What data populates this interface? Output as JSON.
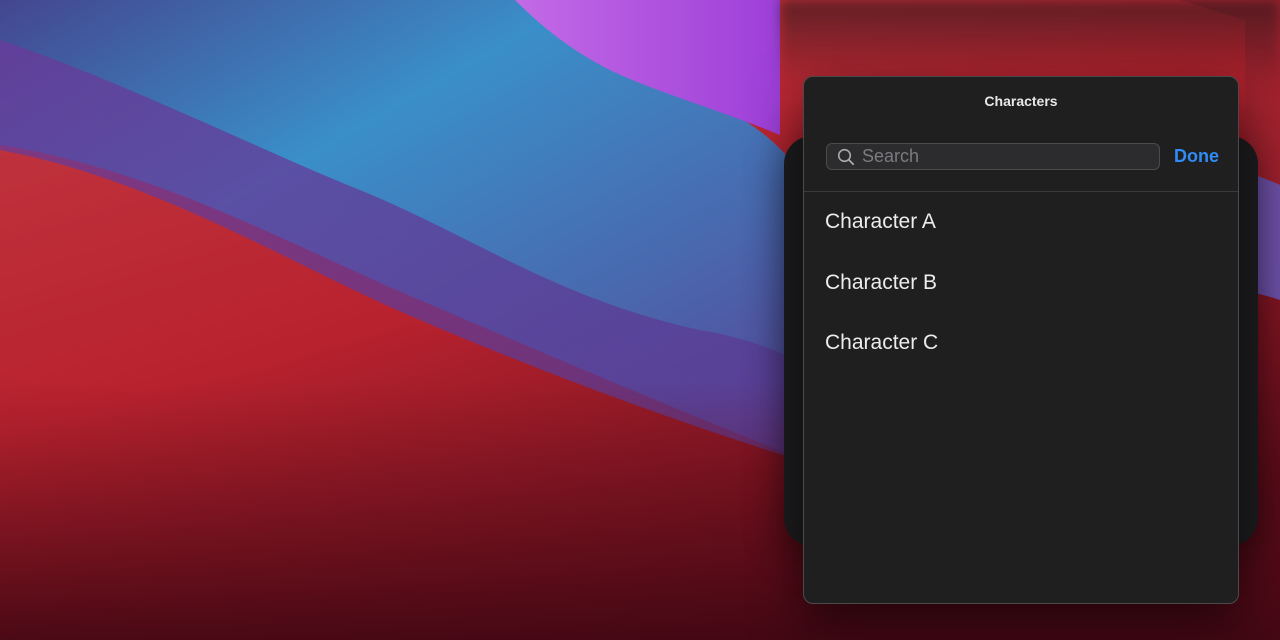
{
  "sheet": {
    "title": "Characters",
    "search": {
      "placeholder": "Search",
      "value": ""
    },
    "done_label": "Done",
    "items": [
      {
        "label": "Character A"
      },
      {
        "label": "Character B"
      },
      {
        "label": "Character C"
      }
    ]
  },
  "colors": {
    "accent": "#2f8cf6",
    "sheet_background": "#1f1f1f",
    "text": "#ececec"
  },
  "icons": {
    "search": "magnifying-glass"
  }
}
